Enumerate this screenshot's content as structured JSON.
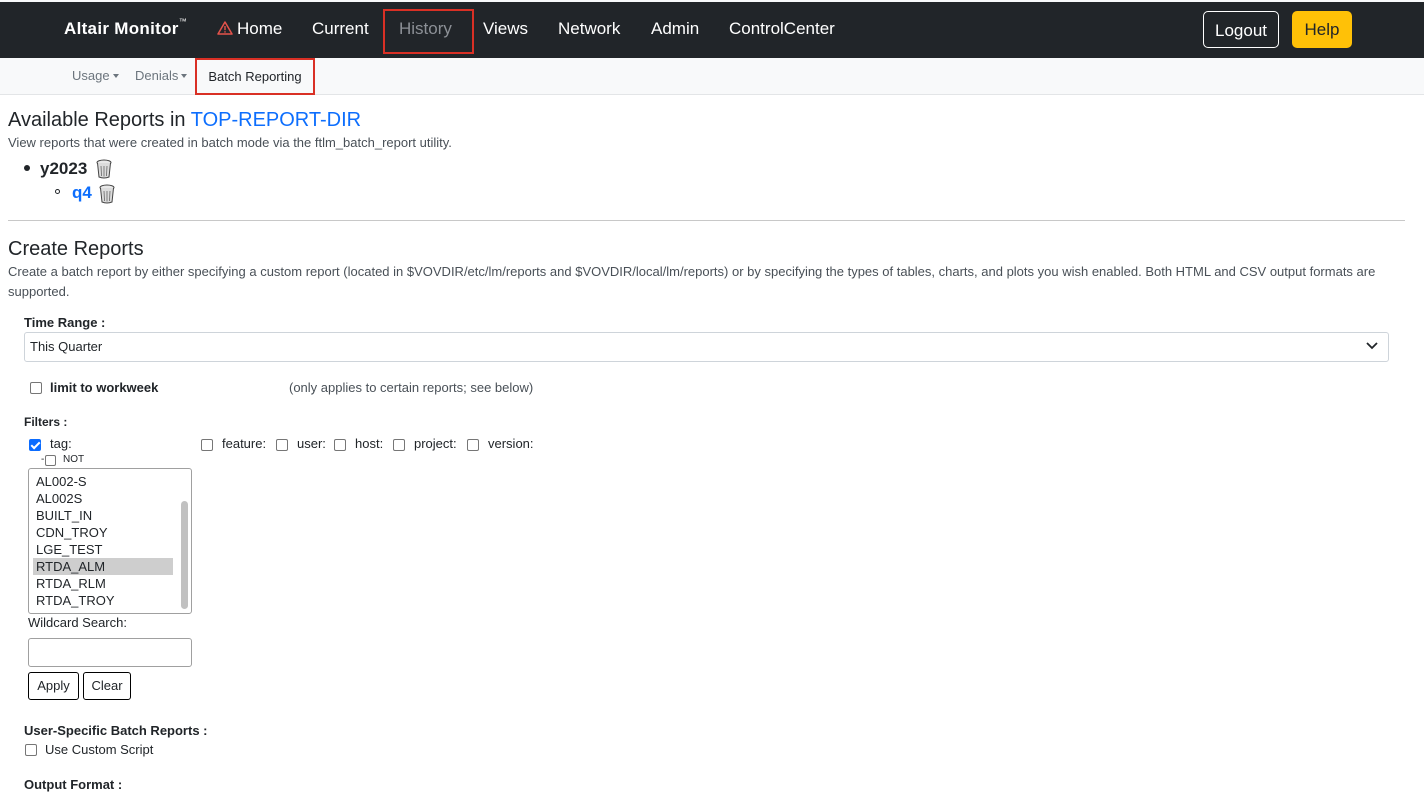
{
  "navbar": {
    "brand": "Altair Monitor",
    "brand_tm": "™",
    "items": [
      "Home",
      "Current",
      "History",
      "Views",
      "Network",
      "Admin",
      "ControlCenter"
    ],
    "logout": "Logout",
    "help": "Help"
  },
  "subnav": {
    "usage": "Usage",
    "denials": "Denials",
    "batch": "Batch Reporting"
  },
  "available": {
    "title_prefix": "Available Reports in ",
    "title_link": "TOP-REPORT-DIR",
    "subtitle": "View reports that were created in batch mode via the ftlm_batch_report utility.",
    "tree": {
      "year": "y2023",
      "quarter": "q4"
    }
  },
  "create": {
    "title": "Create Reports",
    "description": "Create a batch report by either specifying a custom report (located in $VOVDIR/etc/lm/reports and $VOVDIR/local/lm/reports) or by specifying the types of tables, charts, and plots you wish enabled. Both HTML and CSV output formats are supported.",
    "time_range_label": "Time Range :",
    "time_range_value": "This Quarter",
    "workweek_label": "limit to workweek",
    "workweek_note": "(only applies to certain reports; see below)",
    "filters_label": "Filters :",
    "filters": {
      "tag": "tag:",
      "not": "NOT",
      "feature": "feature:",
      "user": "user:",
      "host": "host:",
      "project": "project:",
      "version": "version:"
    },
    "tag_options": [
      "AL002-S",
      "AL002S",
      "BUILT_IN",
      "CDN_TROY",
      "LGE_TEST",
      "RTDA_ALM",
      "RTDA_RLM",
      "RTDA_TROY"
    ],
    "tag_selected": "RTDA_ALM",
    "wildcard_label": "Wildcard Search:",
    "wildcard_value": "",
    "apply": "Apply",
    "clear": "Clear",
    "user_specific_label": "User-Specific Batch Reports :",
    "custom_script_label": "Use Custom Script",
    "output_format_label": "Output Format :"
  },
  "colors": {
    "navbar_bg": "#212529",
    "link": "#0d6efd",
    "help_bg": "#ffc107",
    "highlight": "#d93025"
  }
}
